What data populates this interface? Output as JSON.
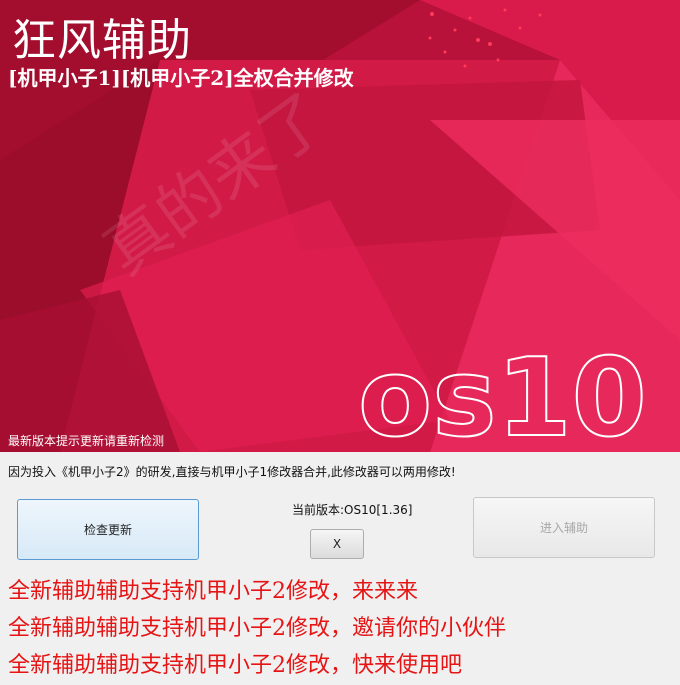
{
  "banner": {
    "title": "狂风辅助",
    "subtitle": "[机甲小子1][机甲小子2]全权合并修改",
    "watermark": "真的来了",
    "logo_text": "os10",
    "update_hint": "最新版本提示更新请重新检测"
  },
  "notice": "因为投入《机甲小子2》的研发,直接与机甲小子1修改器合并,此修改器可以两用修改!",
  "controls": {
    "check_update_label": "检查更新",
    "version_label": "当前版本:OS10[1.36]",
    "close_label": "X",
    "enter_label": "进入辅助"
  },
  "promo_lines": [
    "全新辅助辅助支持机甲小子2修改，来来来",
    "全新辅助辅助支持机甲小子2修改，邀请你的小伙伴",
    "全新辅助辅助支持机甲小子2修改，快来使用吧"
  ],
  "colors": {
    "banner_base": "#c2143c",
    "promo_text": "#e61414",
    "panel_bg": "#f0f0f0"
  }
}
